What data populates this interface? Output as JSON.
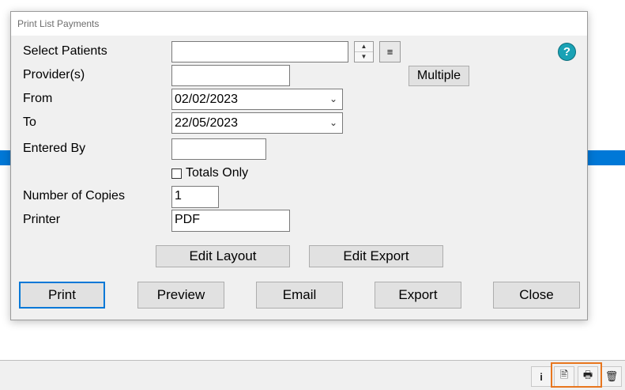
{
  "dialog": {
    "title": "Print List Payments",
    "labels": {
      "select_patients": "Select Patients",
      "providers": "Provider(s)",
      "from": "From",
      "to": "To",
      "entered_by": "Entered By",
      "number_of_copies": "Number of Copies",
      "printer": "Printer"
    },
    "fields": {
      "select_patients": "",
      "providers": "",
      "from_date": "02/02/2023",
      "to_date": "22/05/2023",
      "entered_by": "",
      "number_of_copies": "1",
      "printer": "PDF"
    },
    "totals_only": {
      "label": "Totals Only",
      "checked": false
    },
    "buttons": {
      "multiple": "Multiple",
      "edit_layout": "Edit Layout",
      "edit_export": "Edit Export",
      "print": "Print",
      "preview": "Preview",
      "email": "Email",
      "export": "Export",
      "close": "Close"
    },
    "icons": {
      "help": "?",
      "spin_up": "▲",
      "spin_down": "▼",
      "list": "≡",
      "dropdown": "⌄"
    }
  },
  "status_bar": {
    "info_icon": "i",
    "print_icon": "🖹",
    "printer_icon": "🖶",
    "trash_icon": "🗑"
  },
  "colors": {
    "accent_blue": "#0078d7",
    "help_teal": "#1aa2b5",
    "highlight_orange": "#e8761e",
    "dialog_bg": "#f0f0f0"
  }
}
